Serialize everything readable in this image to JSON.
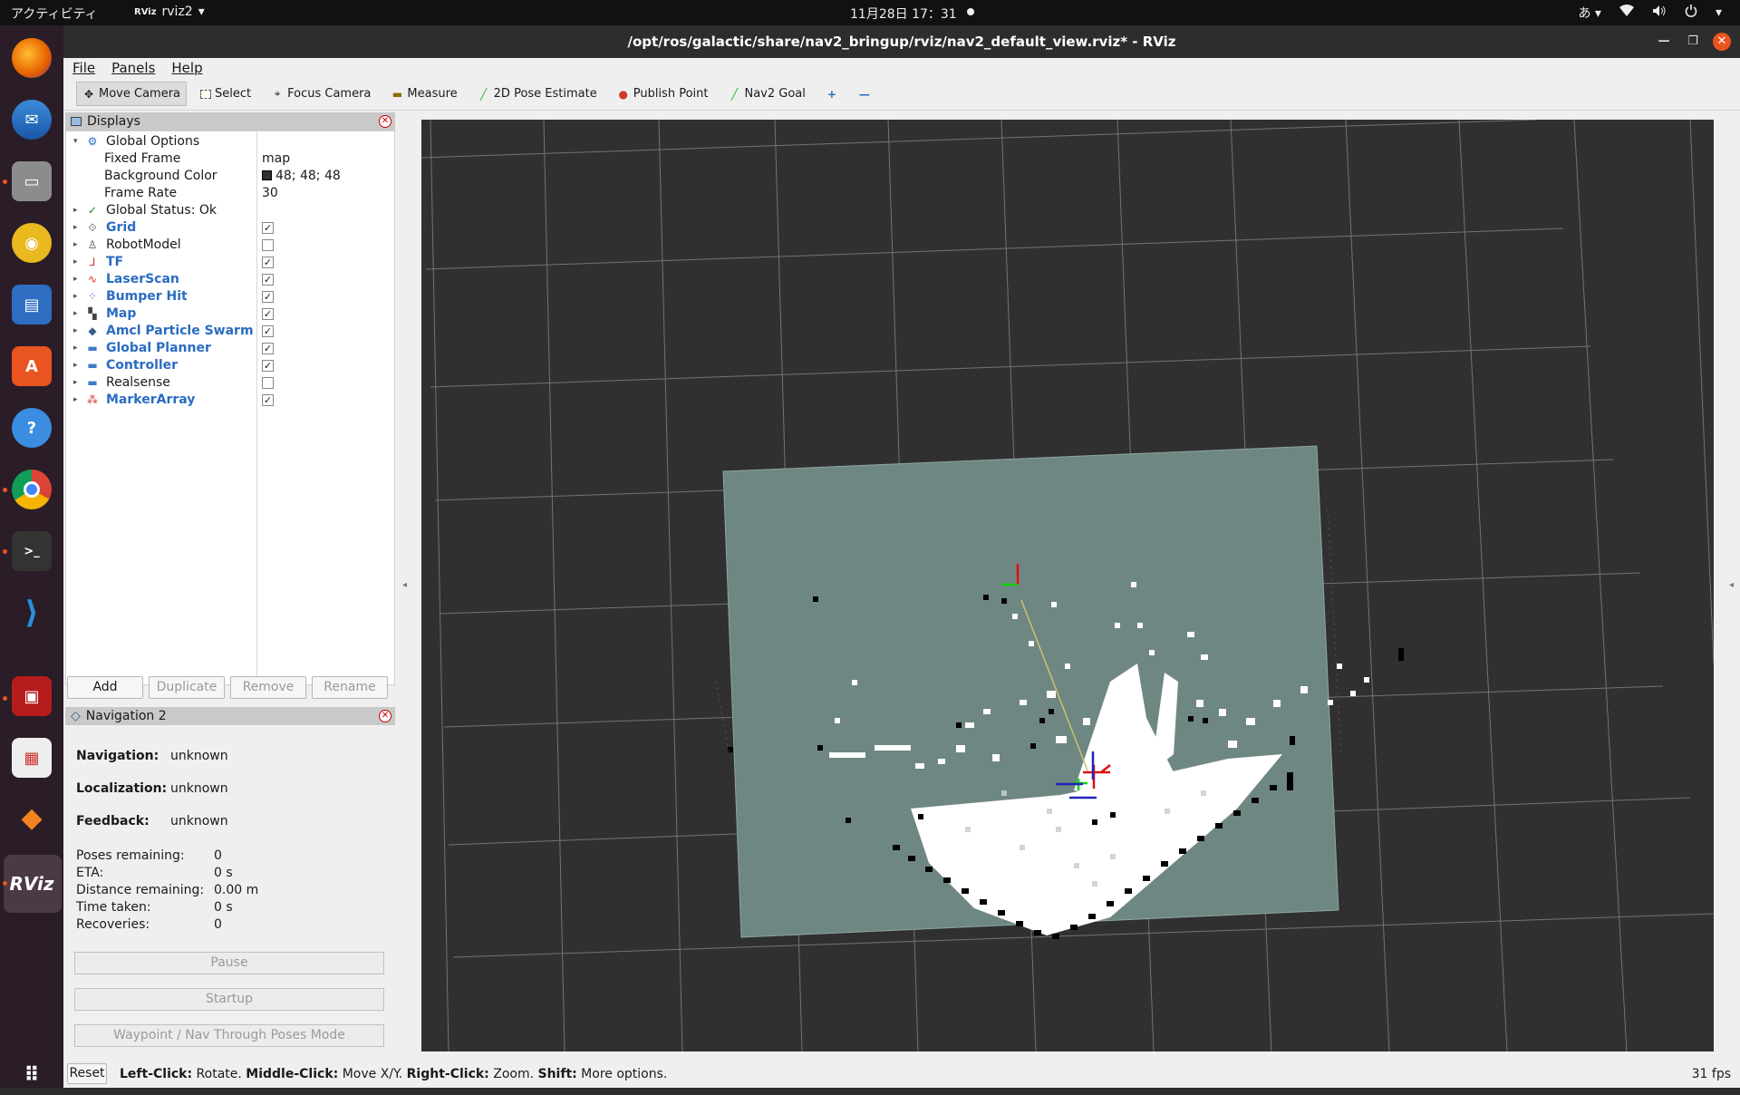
{
  "topbar": {
    "activities": "アクティビティ",
    "app_logo": "RViz",
    "app_name": "rviz2",
    "clock": "11月28日  17：31",
    "ime": "あ"
  },
  "dock": {
    "items": [
      "firefox-icon",
      "thunderbird-icon",
      "files-icon",
      "rhythmbox-icon",
      "libreoffice-writer-icon",
      "software-center-icon",
      "help-icon",
      "chrome-icon",
      "terminal-icon",
      "vscode-icon",
      "terminator-icon",
      "document-viewer-icon",
      "sublime-icon",
      "rviz-icon",
      "show-apps-icon"
    ]
  },
  "window": {
    "title": "/opt/ros/galactic/share/nav2_bringup/rviz/nav2_default_view.rviz* - RViz"
  },
  "menu": [
    "File",
    "Panels",
    "Help"
  ],
  "toolbar": [
    {
      "label": "Move Camera",
      "icon": "move-camera-icon",
      "active": true
    },
    {
      "label": "Select",
      "icon": "select-icon"
    },
    {
      "label": "Focus Camera",
      "icon": "focus-camera-icon"
    },
    {
      "label": "Measure",
      "icon": "measure-icon"
    },
    {
      "label": "2D Pose Estimate",
      "icon": "pose-estimate-icon"
    },
    {
      "label": "Publish Point",
      "icon": "publish-point-icon"
    },
    {
      "label": "Nav2 Goal",
      "icon": "nav2-goal-icon"
    }
  ],
  "displays": {
    "title": "Displays",
    "global_options": "Global Options",
    "fixed_frame_label": "Fixed Frame",
    "fixed_frame_value": "map",
    "bg_color_label": "Background Color",
    "bg_color_value": "48; 48; 48",
    "frame_rate_label": "Frame Rate",
    "frame_rate_value": "30",
    "global_status": "Global Status: Ok",
    "items": [
      {
        "label": "Grid",
        "checked": true,
        "blue": true
      },
      {
        "label": "RobotModel",
        "checked": false,
        "blue": false
      },
      {
        "label": "TF",
        "checked": true,
        "blue": true
      },
      {
        "label": "LaserScan",
        "checked": true,
        "blue": true
      },
      {
        "label": "Bumper Hit",
        "checked": true,
        "blue": true
      },
      {
        "label": "Map",
        "checked": true,
        "blue": true
      },
      {
        "label": "Amcl Particle Swarm",
        "checked": true,
        "blue": true
      },
      {
        "label": "Global Planner",
        "checked": true,
        "blue": true
      },
      {
        "label": "Controller",
        "checked": true,
        "blue": true
      },
      {
        "label": "Realsense",
        "checked": false,
        "blue": false
      },
      {
        "label": "MarkerArray",
        "checked": true,
        "blue": true
      }
    ],
    "buttons": {
      "add": "Add",
      "duplicate": "Duplicate",
      "remove": "Remove",
      "rename": "Rename"
    }
  },
  "nav2": {
    "title": "Navigation 2",
    "navigation_label": "Navigation:",
    "navigation_value": "unknown",
    "localization_label": "Localization:",
    "localization_value": "unknown",
    "feedback_label": "Feedback:",
    "feedback_value": "unknown",
    "poses_label": "Poses remaining:",
    "poses_value": "0",
    "eta_label": "ETA:",
    "eta_value": "0 s",
    "distance_label": "Distance remaining:",
    "distance_value": "0.00 m",
    "time_label": "Time taken:",
    "time_value": "0 s",
    "recoveries_label": "Recoveries:",
    "recoveries_value": "0",
    "pause": "Pause",
    "startup": "Startup",
    "waypoint": "Waypoint / Nav Through Poses Mode"
  },
  "status": {
    "reset": "Reset",
    "help_left_key": "Left-Click:",
    "help_left": " Rotate. ",
    "help_middle_key": "Middle-Click:",
    "help_middle": " Move X/Y. ",
    "help_right_key": "Right-Click:",
    "help_right": " Zoom. ",
    "help_shift_key": "Shift:",
    "help_shift": " More options.",
    "fps": "31 fps"
  }
}
